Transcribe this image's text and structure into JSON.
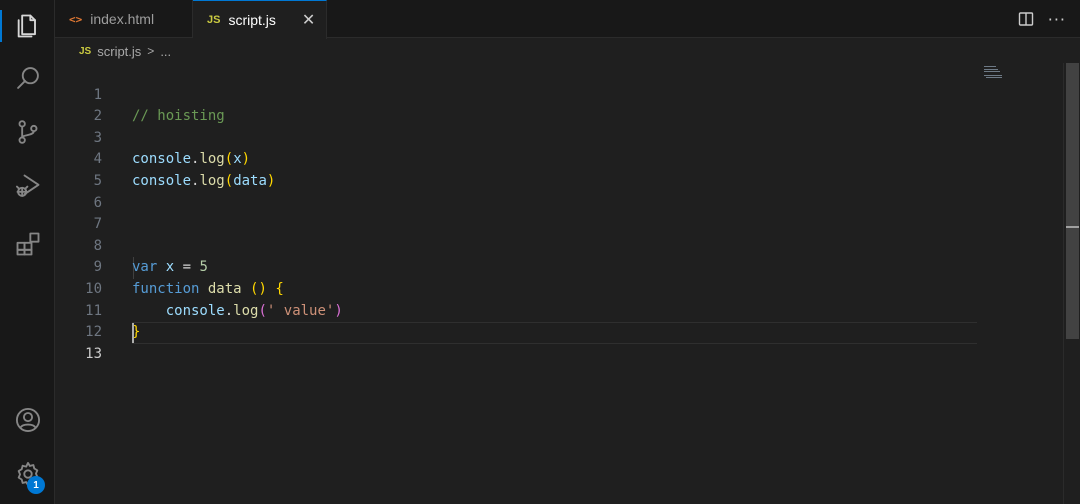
{
  "tabs": [
    {
      "label": "index.html",
      "icon": "html-icon",
      "icon_glyph": "<>",
      "active": false
    },
    {
      "label": "script.js",
      "icon": "js-icon",
      "icon_glyph": "JS",
      "active": true,
      "close_glyph": "✕"
    }
  ],
  "tab_actions": {
    "split_editor": "split-editor-icon",
    "more": "···"
  },
  "breadcrumb": {
    "icon_glyph": "JS",
    "file": "script.js",
    "separator": ">",
    "symbol": "..."
  },
  "editor": {
    "line_numbers": [
      "1",
      "2",
      "3",
      "4",
      "5",
      "6",
      "7",
      "8",
      "9",
      "10",
      "11",
      "12",
      "13"
    ],
    "current_line": 13,
    "code": {
      "line1": {
        "comment": "// hoisting"
      },
      "line3": {
        "obj": "console",
        "dot": ".",
        "method": "log",
        "open": "(",
        "arg": "x",
        "close": ")"
      },
      "line4": {
        "obj": "console",
        "dot": ".",
        "method": "log",
        "open": "(",
        "arg": "data",
        "close": ")"
      },
      "line8": {
        "kw": "var",
        "name": "x",
        "op": "=",
        "value": "5"
      },
      "line9": {
        "kw": "function",
        "name": "data",
        "parens": "()",
        "brace": "{"
      },
      "line10": {
        "obj": "console",
        "dot": ".",
        "method": "log",
        "open": "(",
        "str": "' value'",
        "close": ")"
      },
      "line11": {
        "brace": "}"
      }
    }
  },
  "activity_bar": {
    "items": [
      "explorer-icon",
      "search-icon",
      "source-control-icon",
      "run-debug-icon",
      "extensions-icon"
    ],
    "bottom": [
      "accounts-icon",
      "manage-gear-icon"
    ],
    "manage_badge": "1"
  },
  "colors": {
    "accent": "#0078d4",
    "background": "#1f1f1f",
    "comment": "#6a9955",
    "keyword": "#569cd6",
    "string": "#ce9178"
  }
}
